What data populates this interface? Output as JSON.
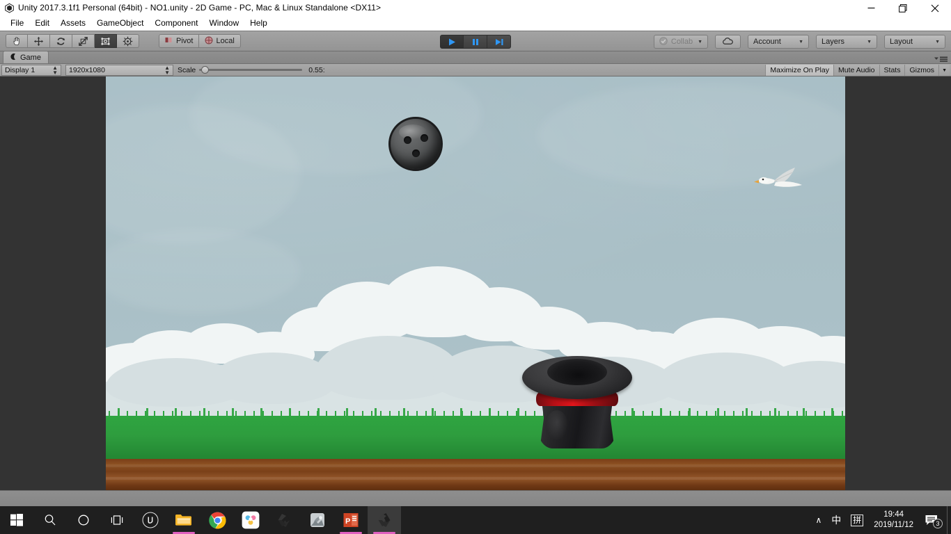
{
  "window": {
    "title": "Unity 2017.3.1f1 Personal (64bit) - NO1.unity - 2D Game - PC, Mac & Linux Standalone <DX11>",
    "app_icon": "unity-icon",
    "minimize_label": "—",
    "restore_label": "restore",
    "close_label": "✕"
  },
  "menubar": {
    "items": [
      {
        "label": "File"
      },
      {
        "label": "Edit"
      },
      {
        "label": "Assets"
      },
      {
        "label": "GameObject"
      },
      {
        "label": "Component"
      },
      {
        "label": "Window"
      },
      {
        "label": "Help"
      }
    ]
  },
  "toolbar": {
    "tools": [
      {
        "name": "hand-tool",
        "selected": false
      },
      {
        "name": "move-tool",
        "selected": false
      },
      {
        "name": "rotate-tool",
        "selected": false
      },
      {
        "name": "scale-tool",
        "selected": false
      },
      {
        "name": "rect-tool",
        "selected": true
      },
      {
        "name": "transform-tool",
        "selected": false
      }
    ],
    "pivot_label": "Pivot",
    "local_label": "Local",
    "play_label": "Play",
    "pause_label": "Pause",
    "step_label": "Step",
    "play_active": true,
    "collab_label": "Collab",
    "cloud_label": "cloud",
    "account_label": "Account",
    "layers_label": "Layers",
    "layout_label": "Layout"
  },
  "panel": {
    "tab_label": "Game",
    "tab_icon": "game-view-icon",
    "menu_icon": "panel-menu-icon",
    "display_value": "Display 1",
    "resolution_value": "1920x1080",
    "scale_label": "Scale",
    "scale_value": "0.55:",
    "scale_percent": 2,
    "maximize_label": "Maximize On Play",
    "mute_label": "Mute Audio",
    "stats_label": "Stats",
    "gizmos_label": "Gizmos"
  },
  "scene": {
    "name": "2D catch-the-ball game scene",
    "sky_color": "#a8bfc6",
    "cloud_light": "#f1f5f5",
    "cloud_shade": "#d5dfe1",
    "grass_color": "#2fa541",
    "dirt_color": "#8d5123",
    "letterbox_color": "#333333",
    "objects": [
      {
        "name": "bowling-ball",
        "label": "Bowling Ball",
        "color": "#4a4c4d",
        "holes": 3
      },
      {
        "name": "top-hat",
        "label": "Top Hat",
        "color": "#1c1c1e",
        "band_color": "#e2161c"
      },
      {
        "name": "seagull",
        "label": "Seagull",
        "color": "#f2f2f0",
        "beak_color": "#e8a33a"
      }
    ]
  },
  "taskbar": {
    "items": [
      {
        "name": "start-button",
        "label": "Start"
      },
      {
        "name": "search-button",
        "label": "Search"
      },
      {
        "name": "cortana-button",
        "label": "Cortana"
      },
      {
        "name": "task-view-button",
        "label": "Task View"
      },
      {
        "name": "unreal-engine-app",
        "label": "Unreal Engine"
      },
      {
        "name": "file-explorer-app",
        "label": "File Explorer"
      },
      {
        "name": "chrome-app",
        "label": "Google Chrome"
      },
      {
        "name": "drive-app",
        "label": "Cloud Drive"
      },
      {
        "name": "unity-app",
        "label": "Unity"
      },
      {
        "name": "unity-hub-app",
        "label": "Unity Hub"
      },
      {
        "name": "powerpoint-app",
        "label": "PowerPoint"
      },
      {
        "name": "unity-active-app",
        "label": "Unity (active)"
      }
    ],
    "tray": {
      "chevron": "∧",
      "ime_mode": "中",
      "ime_pinyin": "拼",
      "time": "19:44",
      "date": "2019/11/12",
      "notification_count": "3"
    }
  }
}
